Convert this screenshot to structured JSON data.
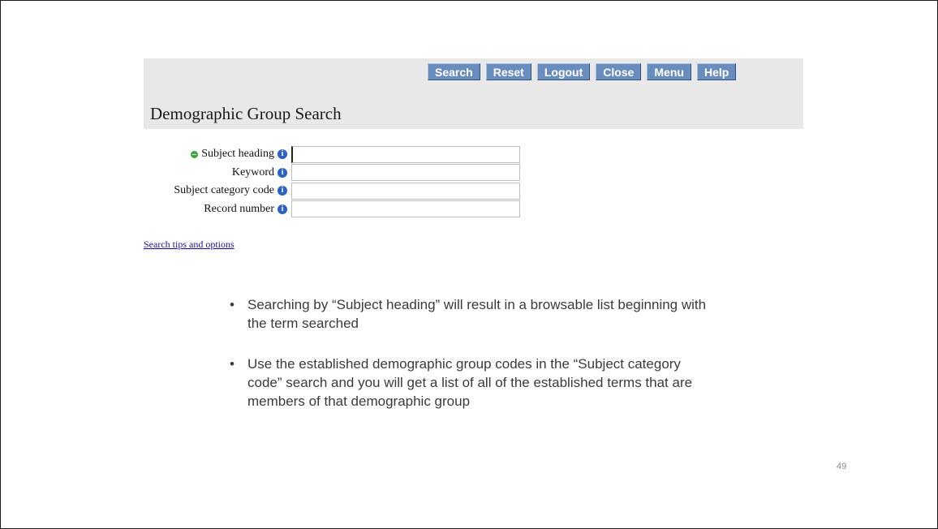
{
  "toolbar": {
    "buttons": [
      "Search",
      "Reset",
      "Logout",
      "Close",
      "Menu",
      "Help"
    ]
  },
  "header": {
    "title": "Demographic Group Search"
  },
  "form": {
    "fields": [
      {
        "label": "Subject heading",
        "value": "",
        "required": true
      },
      {
        "label": "Keyword",
        "value": ""
      },
      {
        "label": "Subject category code",
        "value": ""
      },
      {
        "label": "Record number",
        "value": ""
      }
    ],
    "info_glyph": "i"
  },
  "links": {
    "search_tips": "Search tips and options"
  },
  "notes": {
    "bullet_glyph": "•",
    "items": [
      "Searching by “Subject heading” will result in a browsable list beginning with the term searched",
      "Use the established demographic group codes in the “Subject category code” search and you will get a list of all of the established terms that are members of that demographic group"
    ]
  },
  "slide": {
    "page_number": "49"
  },
  "icons": {
    "required": "required-dot-icon",
    "info": "info-icon"
  },
  "colors": {
    "toolbar_button": "#6a8dc0",
    "header_bg": "#e8e8e8",
    "info_icon": "#2a62c8",
    "required_icon": "#3aa63a",
    "link": "#1a0dab"
  }
}
